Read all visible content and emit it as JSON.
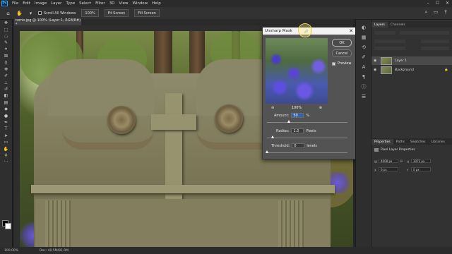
{
  "menubar": {
    "items": [
      "File",
      "Edit",
      "Image",
      "Layer",
      "Type",
      "Select",
      "Filter",
      "3D",
      "View",
      "Window",
      "Help"
    ]
  },
  "options": {
    "scroll_all": "Scroll All Windows",
    "zoom_pct": "100%",
    "fit_screen": "Fit Screen",
    "fill_screen": "Fill Screen"
  },
  "document": {
    "tab_title": "tomb.jpg @ 100% (Layer 1, RGB/8#) *"
  },
  "dialog": {
    "title": "Unsharp Mask",
    "ok": "OK",
    "cancel": "Cancel",
    "preview_label": "Preview",
    "zoom": "100%",
    "amount_label": "Amount:",
    "amount_value": "50",
    "amount_unit": "%",
    "radius_label": "Radius:",
    "radius_value": "1.0",
    "radius_unit": "Pixels",
    "threshold_label": "Threshold:",
    "threshold_value": "0",
    "threshold_unit": "levels"
  },
  "panels": {
    "layers_tab": "Layers",
    "channels_tab": "Channels",
    "layer1": "Layer 1",
    "background": "Background",
    "properties_tab": "Properties",
    "paths_tab": "Paths",
    "swatches_tab": "Swatches",
    "libraries_tab": "Libraries",
    "pixel_layer": "Pixel Layer Properties",
    "w": "4608 px",
    "h": "3072 px",
    "x": "0 px",
    "y": "0 px"
  },
  "status": {
    "zoom": "100.00%",
    "doc": "Doc: 40.5M/81.0M"
  }
}
